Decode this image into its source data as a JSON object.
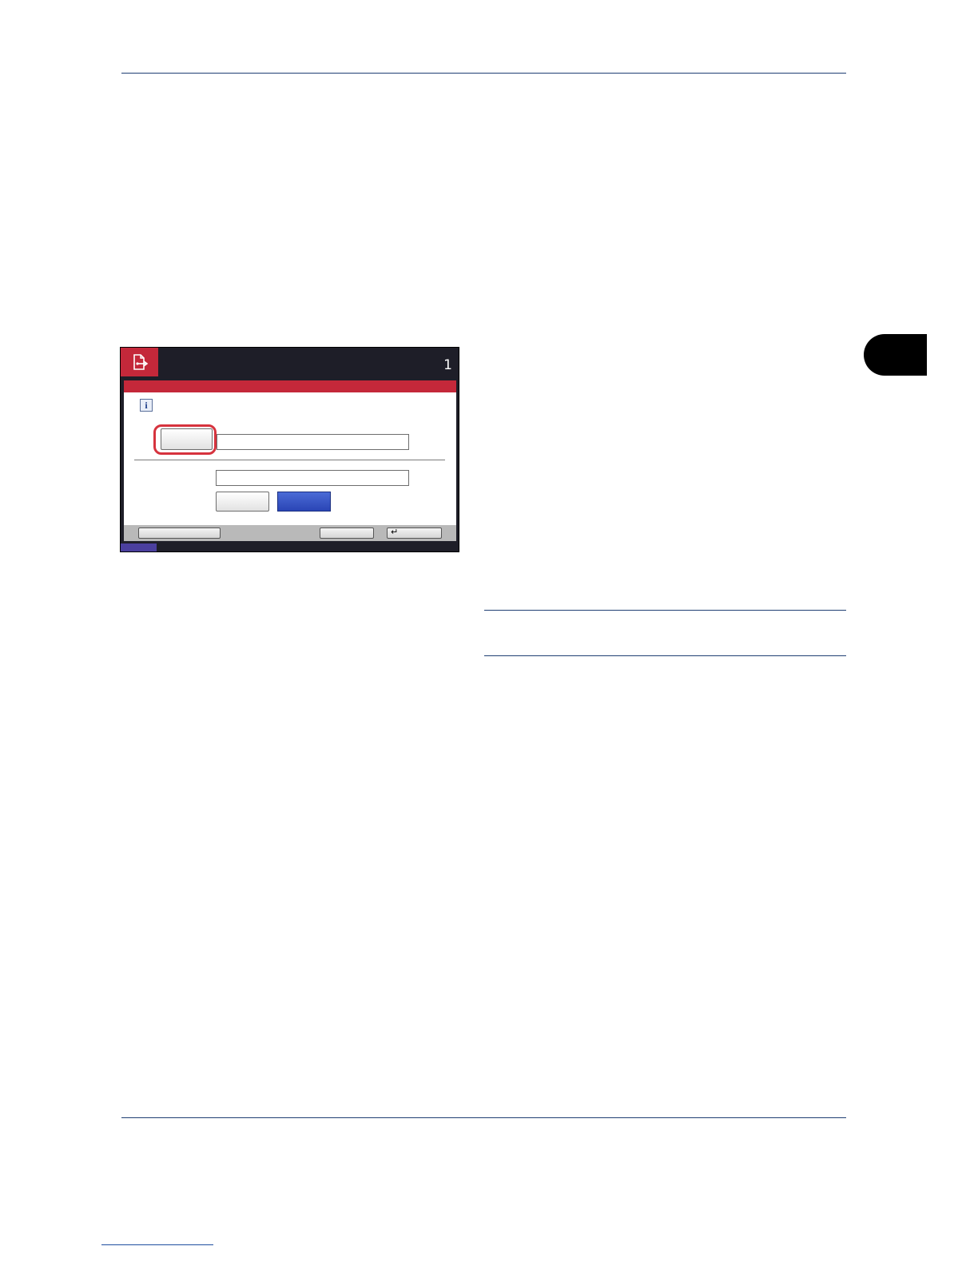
{
  "panel": {
    "count": "1",
    "info_glyph": "i",
    "enter_glyph": "↵",
    "icons": {
      "job": "document-send-icon",
      "info": "info-icon",
      "enter": "enter-icon"
    },
    "colors": {
      "brand_red": "#c4283a",
      "highlight_red": "#d6333e",
      "panel_dark": "#1e1e28",
      "ok_blue": "#2a45b5",
      "status_purple": "#4b3f9e"
    }
  },
  "chapter_tab": {
    "color": "#000000"
  }
}
